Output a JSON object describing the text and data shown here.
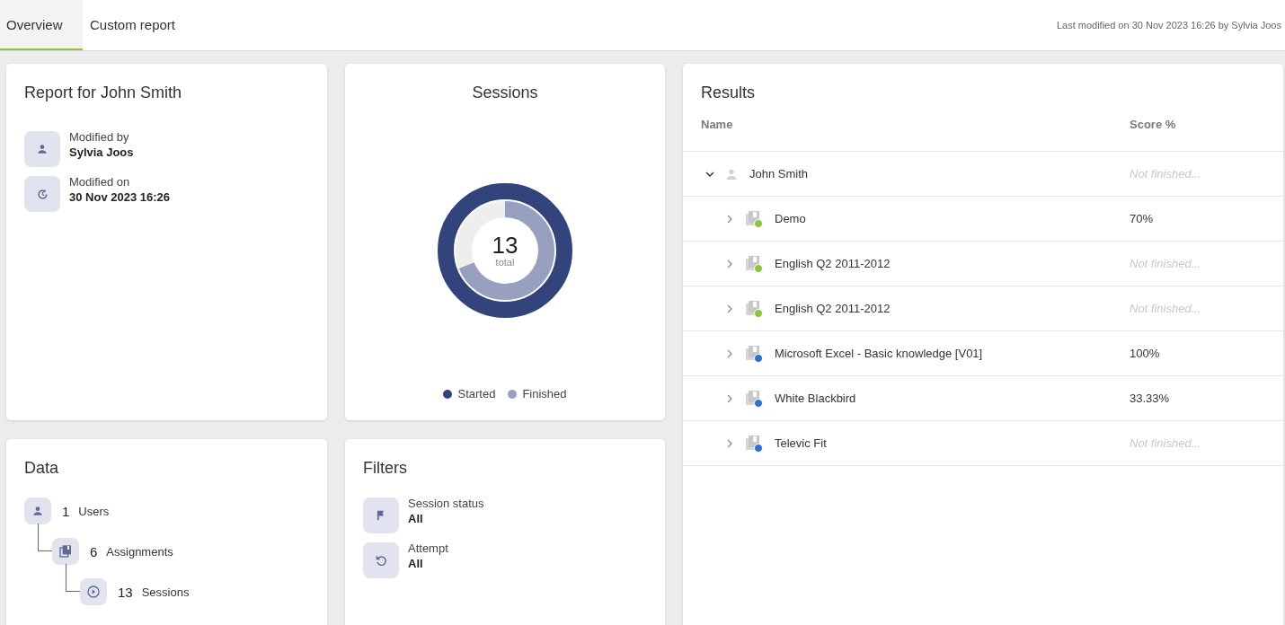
{
  "tabs": [
    {
      "label": "Overview",
      "selected": true
    },
    {
      "label": "Custom report",
      "selected": false
    }
  ],
  "last_modified": "Last modified on 30 Nov 2023 16:26 by Sylvia Joos",
  "report_card": {
    "title": "Report for John Smith",
    "fields": [
      {
        "kind": "person",
        "label": "Modified by",
        "value": "Sylvia Joos"
      },
      {
        "kind": "history",
        "label": "Modified on",
        "value": "30 Nov 2023 16:26"
      }
    ]
  },
  "sessions_card": {
    "title": "Sessions",
    "total": "13",
    "total_label": "total",
    "rings": [
      {
        "name": "Started",
        "color": "#33447c",
        "level": 1
      },
      {
        "name": "Finished",
        "color": "#97a1bf",
        "level": 0.69
      }
    ]
  },
  "data_card": {
    "title": "Data",
    "tree": [
      {
        "kind": "person",
        "count": "1",
        "label": "Users",
        "children": [
          {
            "kind": "books",
            "count": "6",
            "label": "Assignments",
            "children": [
              {
                "kind": "play",
                "count": "13",
                "label": "Sessions"
              }
            ]
          }
        ]
      }
    ]
  },
  "filters_card": {
    "title": "Filters",
    "fields": [
      {
        "kind": "flag",
        "label": "Session status",
        "value": "All"
      },
      {
        "kind": "undo",
        "label": "Attempt",
        "value": "All"
      }
    ]
  },
  "results": {
    "title": "Results",
    "columns": [
      "Name",
      "Score %"
    ],
    "rows": [
      {
        "name": "John Smith",
        "score": "Not finished...",
        "finished": false,
        "expanded": true,
        "children": [
          {
            "name": "Demo",
            "score": "70%",
            "finished": true,
            "expanded": false,
            "color": "#8cc63f"
          },
          {
            "name": "English Q2 2011-2012",
            "score": "Not finished...",
            "finished": false,
            "expanded": false,
            "color": "#8cc63f"
          },
          {
            "name": "English Q2 2011-2012",
            "score": "Not finished...",
            "finished": false,
            "expanded": false,
            "color": "#8cc63f"
          },
          {
            "name": "Microsoft Excel - Basic knowledge [V01]",
            "score": "100%",
            "finished": true,
            "expanded": false,
            "color": "#2f6fd6"
          },
          {
            "name": "White Blackbird",
            "score": "33.33%",
            "finished": true,
            "expanded": false,
            "color": "#2f6fd6"
          },
          {
            "name": "Televic Fit",
            "score": "Not finished...",
            "finished": false,
            "expanded": false,
            "color": "#2f6fd6"
          }
        ]
      }
    ]
  }
}
